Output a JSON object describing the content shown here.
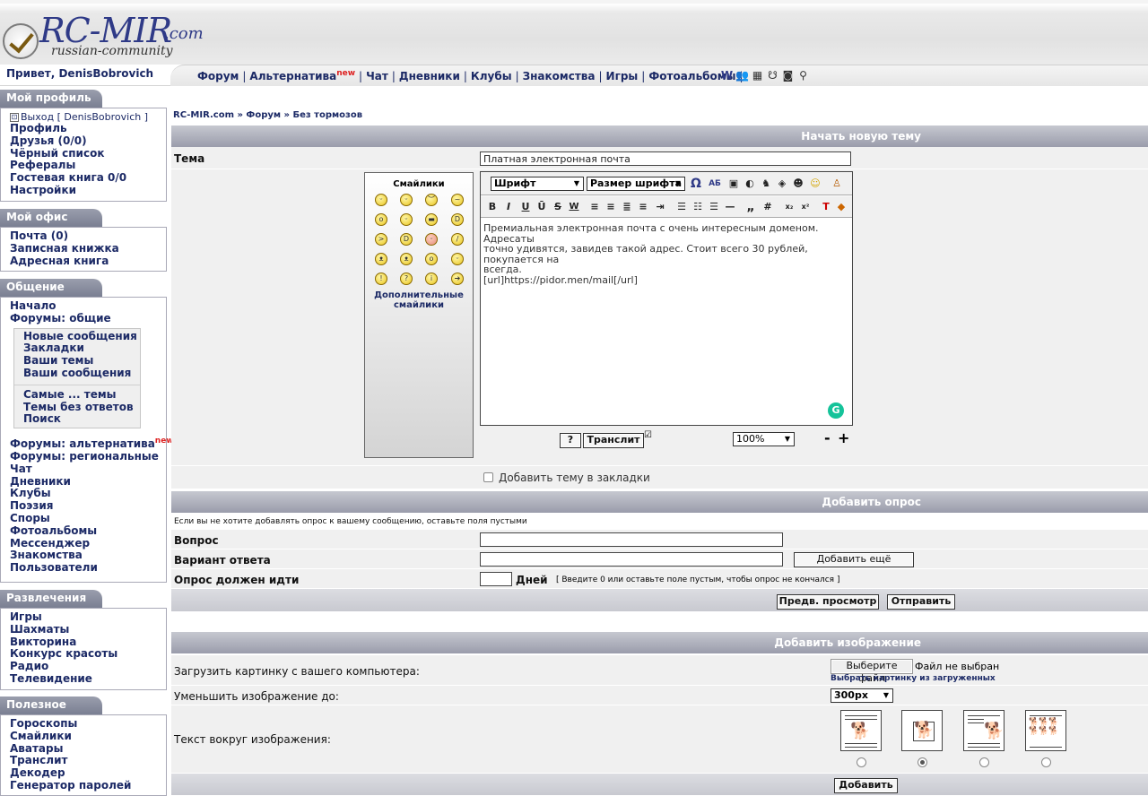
{
  "logo": {
    "name": "RC-MIR",
    "domain": ".com",
    "tagline": "russian-community"
  },
  "greeting": "Привет, DenisBobrovich",
  "nav": {
    "links": [
      {
        "label": "Форум"
      },
      {
        "label": "Альтернатива",
        "badge": "new"
      },
      {
        "label": "Чат"
      },
      {
        "label": "Дневники"
      },
      {
        "label": "Клубы"
      },
      {
        "label": "Знакомства"
      },
      {
        "label": "Игры"
      },
      {
        "label": "Фотоальбомы"
      }
    ],
    "icons": [
      "letter-w-icon",
      "users-icon",
      "calendar-icon",
      "mask-icon",
      "tv-icon",
      "search-icon"
    ]
  },
  "sidebar": {
    "profile": {
      "title": "Мой профиль",
      "logout": "Выход [ DenisBobrovich ]",
      "items": [
        "Профиль",
        "Друзья (0/0)",
        "Чёрный список",
        "Рефералы",
        "Гостевая книга 0/0",
        "Настройки"
      ]
    },
    "office": {
      "title": "Мой офис",
      "items": [
        "Почта (0)",
        "Записная книжка",
        "Адресная книга"
      ]
    },
    "social": {
      "title": "Общение",
      "top": [
        "Начало",
        "Форумы: общие"
      ],
      "sub1": [
        "Новые сообщения",
        "Закладки",
        "Ваши темы",
        "Ваши сообщения"
      ],
      "sub2": [
        "Самые ... темы",
        "Темы без ответов",
        "Поиск"
      ],
      "alt_label": "Форумы: альтернатива",
      "alt_badge": "new",
      "rest": [
        "Форумы: региональные",
        "Чат",
        "Дневники",
        "Клубы",
        "Поэзия",
        "Споры",
        "Фотоальбомы",
        "Мессенджер",
        "Знакомства",
        "Пользователи"
      ]
    },
    "fun": {
      "title": "Развлечения",
      "items": [
        "Игры",
        "Шахматы",
        "Викторина",
        "Конкурс красоты",
        "Радио",
        "Телевидение"
      ]
    },
    "useful": {
      "title": "Полезное",
      "items": [
        "Гороскопы",
        "Смайлики",
        "Аватары",
        "Транслит",
        "Декодер",
        "Генератор паролей"
      ]
    }
  },
  "breadcrumb": "RC-MIR.com » Форум » Без тормозов",
  "new_topic": {
    "header": "Начать новую тему",
    "subject_label": "Тема",
    "subject_value": "Платная электронная почта",
    "smileys_title": "Смайлики",
    "more_smileys": "Дополнительные смайлики",
    "font_select": "Шрифт",
    "size_select": "Размер шрифта",
    "toolbar1": [
      "Ω",
      "АБ"
    ],
    "toolbar2": [
      "B",
      "I",
      "U",
      "Ū",
      "S",
      "W"
    ],
    "body_lines": [
      "Премиальная электронная почта с очень интересным доменом. Адресаты",
      "точно удивятся, завидев такой адрес. Стоит всего 30 рублей, покупается на",
      "всегда.",
      "[url]https://pidor.men/mail[/url]"
    ],
    "help_btn": "?",
    "translit_btn": "Транслит",
    "zoom": "100%",
    "zoom_minus": "-",
    "zoom_plus": "+",
    "bookmark_label": "Добавить тему в закладки"
  },
  "poll": {
    "header": "Добавить опрос",
    "hint": "Если вы не хотите добавлять опрос к вашему сообщению, оставьте поля пустыми",
    "question_label": "Вопрос",
    "answer_label": "Вариант ответа",
    "add_variant_btn": "Добавить ещё вариант",
    "duration_label": "Опрос должен идти",
    "days_label": "Дней",
    "duration_hint": "[ Введите 0 или оставьте поле пустым, чтобы опрос не кончался ]",
    "preview_btn": "Предв. просмотр",
    "send_btn": "Отправить"
  },
  "image": {
    "header": "Добавить изображение",
    "upload_label": "Загрузить картинку с вашего компьютера:",
    "choose_file_btn": "Выберите файл",
    "no_file": "Файл не выбран",
    "choose_uploaded": "Выбрать картинку из загруженных",
    "resize_label": "Уменьшить изображение до:",
    "resize_value": "300px",
    "wrap_label": "Текст вокруг изображения:",
    "wrap_selected": 2,
    "add_btn": "Добавить"
  }
}
